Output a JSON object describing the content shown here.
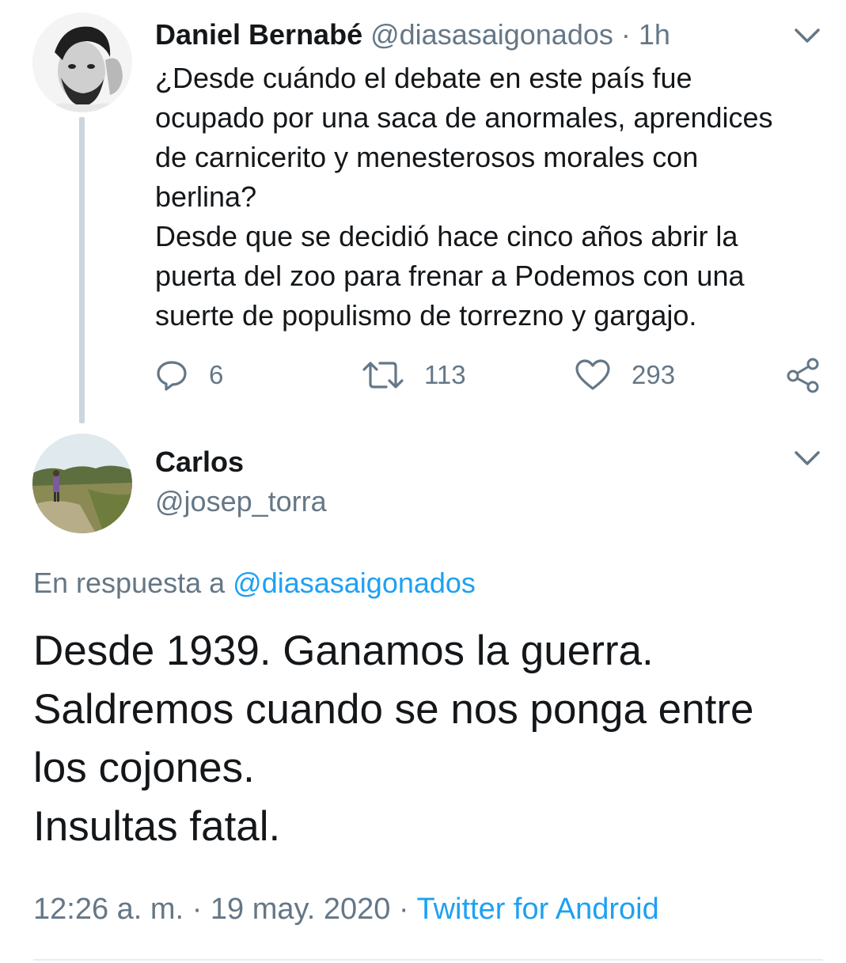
{
  "parent_tweet": {
    "author_name": "Daniel Bernabé",
    "author_handle": "@diasasaigonados",
    "separator": "·",
    "time_ago": "1h",
    "text": "¿Desde cuándo el debate en este país fue\nocupado por una saca de anormales, aprendices\nde carnicerito y menesterosos morales con\nberlina?\nDesde que se decidió hace cinco años abrir la\npuerta del zoo para frenar a Podemos con una\nsuerte de populismo de torrezno y gargajo.",
    "actions": {
      "reply_icon": "reply-icon",
      "reply_count": "6",
      "retweet_icon": "retweet-icon",
      "retweet_count": "113",
      "like_icon": "heart-icon",
      "like_count": "293",
      "share_icon": "share-icon"
    }
  },
  "reply_tweet": {
    "author_name": "Carlos",
    "author_handle": "@josep_torra",
    "reply_prefix": "En respuesta a",
    "reply_to_handle": "@diasasaigonados",
    "text": "Desde 1939. Ganamos la guerra.\nSaldremos cuando se nos ponga entre\nlos cojones.\nInsultas fatal.",
    "time": "12:26 a. m.",
    "separator": "·",
    "date": "19 may. 2020",
    "source": "Twitter for Android"
  },
  "colors": {
    "text": "#14171a",
    "muted": "#657786",
    "link": "#1da1f2",
    "thread_line": "#ccd6dd"
  }
}
